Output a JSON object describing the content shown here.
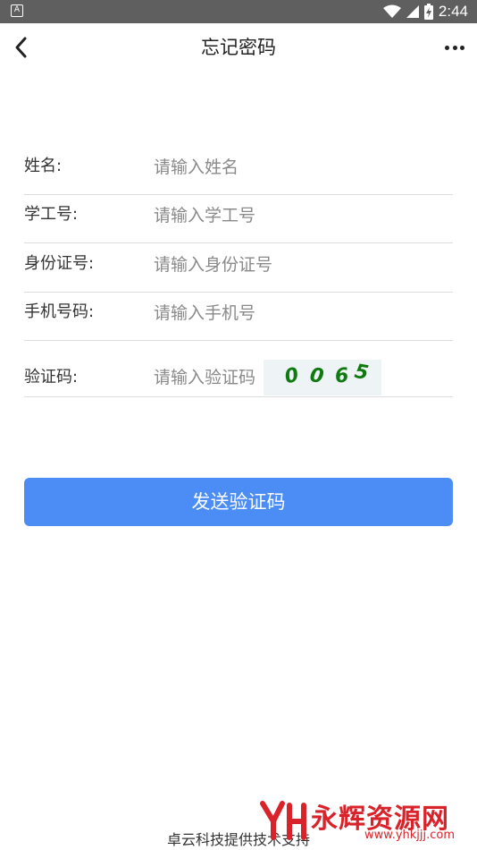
{
  "status_bar": {
    "left_icon_label": "A",
    "time": "2:44",
    "icons": [
      "wifi-icon",
      "signal-icon",
      "battery-charging-icon"
    ]
  },
  "navbar": {
    "title": "忘记密码",
    "back_icon": "chevron-left-icon",
    "more_icon": "more-horizontal-icon"
  },
  "form": {
    "rows": [
      {
        "label": "姓名:",
        "placeholder": "请输入姓名",
        "value": ""
      },
      {
        "label": "学工号:",
        "placeholder": "请输入学工号",
        "value": ""
      },
      {
        "label": "身份证号:",
        "placeholder": "请输入身份证号",
        "value": ""
      },
      {
        "label": "手机号码:",
        "placeholder": "请输入手机号",
        "value": ""
      },
      {
        "label": "验证码:",
        "placeholder": "请输入验证码",
        "value": ""
      }
    ],
    "captcha_chars": [
      "0",
      "0",
      "6",
      "5"
    ],
    "captcha_color": "#0f7a0f"
  },
  "submit": {
    "label": "发送验证码",
    "color": "#4c8cf5"
  },
  "footer": {
    "text": "卓云科技提供技术支持"
  },
  "watermark": {
    "text": "永辉资源网",
    "url": "www.yhkjjj.com",
    "color": "#d9232a"
  }
}
